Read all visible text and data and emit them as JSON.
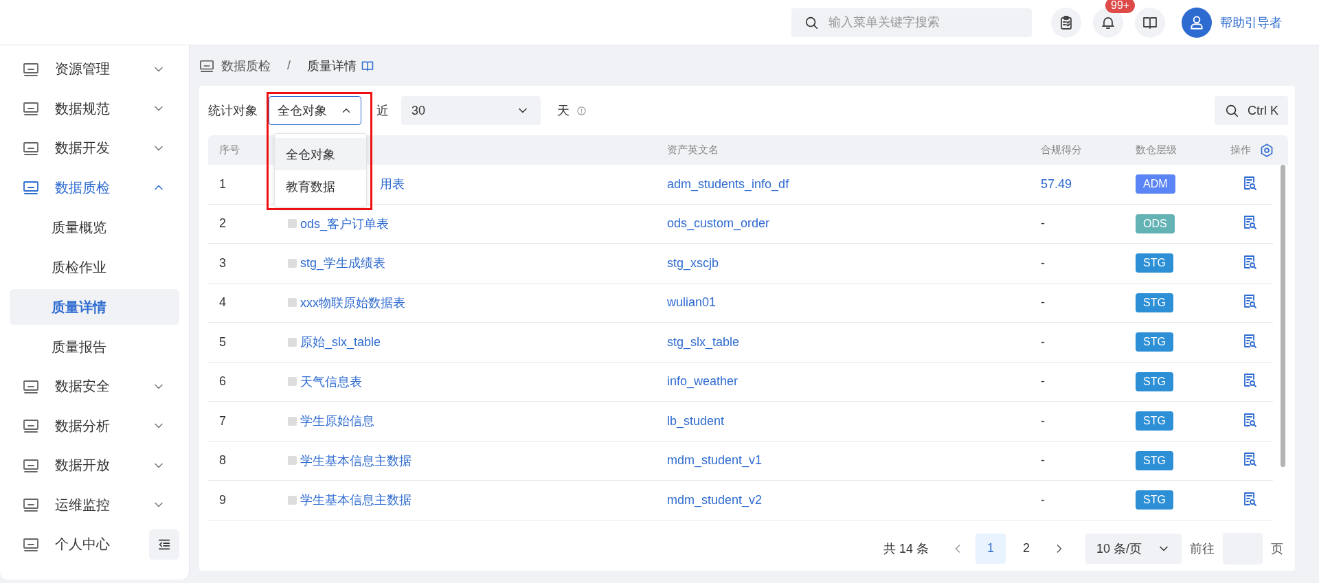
{
  "topbar": {
    "search": {
      "placeholder": "输入菜单关键字搜索"
    },
    "notification_badge": "99+",
    "user": {
      "name": "帮助引导者"
    }
  },
  "sidebar": {
    "items": [
      {
        "label": "资源管理",
        "kind": "group",
        "expanded": false
      },
      {
        "label": "数据规范",
        "kind": "group",
        "expanded": false
      },
      {
        "label": "数据开发",
        "kind": "group",
        "expanded": false
      },
      {
        "label": "数据质检",
        "kind": "group",
        "expanded": true,
        "children": [
          {
            "label": "质量概览",
            "selected": false
          },
          {
            "label": "质检作业",
            "selected": false
          },
          {
            "label": "质量详情",
            "selected": true
          },
          {
            "label": "质量报告",
            "selected": false
          }
        ]
      },
      {
        "label": "数据安全",
        "kind": "group",
        "expanded": false
      },
      {
        "label": "数据分析",
        "kind": "group",
        "expanded": false
      },
      {
        "label": "数据开放",
        "kind": "group",
        "expanded": false
      },
      {
        "label": "运维监控",
        "kind": "group",
        "expanded": false
      },
      {
        "label": "个人中心",
        "kind": "link"
      }
    ]
  },
  "breadcrumb": [
    "数据质检",
    "质量详情"
  ],
  "breadcrumb_separator": "/",
  "filter": {
    "label": "统计对象",
    "select": {
      "value": "全仓对象",
      "open": true,
      "highlighted": true,
      "options": [
        {
          "label": "全仓对象",
          "selected": true
        },
        {
          "label": "教育数据",
          "selected": false
        }
      ]
    },
    "prefix": "近",
    "days": {
      "value": "30"
    },
    "suffix": "天",
    "search_shortcut": "Ctrl K"
  },
  "table": {
    "header": {
      "index": "序号",
      "english_name": "资产英文名",
      "score": "合规得分",
      "layer": "数仓层级",
      "actions": "操作"
    },
    "rows": [
      {
        "index": "1",
        "name": "用表",
        "kind": "covered",
        "english_name": "adm_students_info_df",
        "score": {
          "text": "57.49",
          "linked": true
        },
        "layer": {
          "label": "ADM",
          "color": "#5b84f6"
        }
      },
      {
        "index": "2",
        "name": "ods_客户订单表",
        "kind": "plain",
        "english_name": "ods_custom_order",
        "score": {
          "text": "-",
          "linked": false
        },
        "layer": {
          "label": "ODS",
          "color": "#63b2b4"
        }
      },
      {
        "index": "3",
        "name": "stg_学生成绩表",
        "kind": "plain",
        "english_name": "stg_xscjb",
        "score": {
          "text": "-",
          "linked": false
        },
        "layer": {
          "label": "STG",
          "color": "#2d8fd5"
        }
      },
      {
        "index": "4",
        "name": "xxx物联原始数据表",
        "kind": "plain",
        "english_name": "wulian01",
        "score": {
          "text": "-",
          "linked": false
        },
        "layer": {
          "label": "STG",
          "color": "#2d8fd5"
        }
      },
      {
        "index": "5",
        "name": "原始_slx_table",
        "kind": "plain",
        "english_name": "stg_slx_table",
        "score": {
          "text": "-",
          "linked": false
        },
        "layer": {
          "label": "STG",
          "color": "#2d8fd5"
        }
      },
      {
        "index": "6",
        "name": "天气信息表",
        "kind": "plain",
        "english_name": "info_weather",
        "score": {
          "text": "-",
          "linked": false
        },
        "layer": {
          "label": "STG",
          "color": "#2d8fd5"
        }
      },
      {
        "index": "7",
        "name": "学生原始信息",
        "kind": "plain",
        "english_name": "lb_student",
        "score": {
          "text": "-",
          "linked": false
        },
        "layer": {
          "label": "STG",
          "color": "#2d8fd5"
        }
      },
      {
        "index": "8",
        "name": "学生基本信息主数据",
        "kind": "plain",
        "english_name": "mdm_student_v1",
        "score": {
          "text": "-",
          "linked": false
        },
        "layer": {
          "label": "STG",
          "color": "#2d8fd5"
        }
      },
      {
        "index": "9",
        "name": "学生基本信息主数据",
        "kind": "plain",
        "english_name": "mdm_student_v2",
        "score": {
          "text": "-",
          "linked": false
        },
        "layer": {
          "label": "STG",
          "color": "#2d8fd5"
        }
      }
    ]
  },
  "pagination": {
    "total": "共 14 条",
    "pages": [
      {
        "label": "1",
        "selected": true
      },
      {
        "label": "2",
        "selected": false
      }
    ],
    "page_size": "10 条/页",
    "goto_label": "前往",
    "goto_suffix": "页"
  }
}
